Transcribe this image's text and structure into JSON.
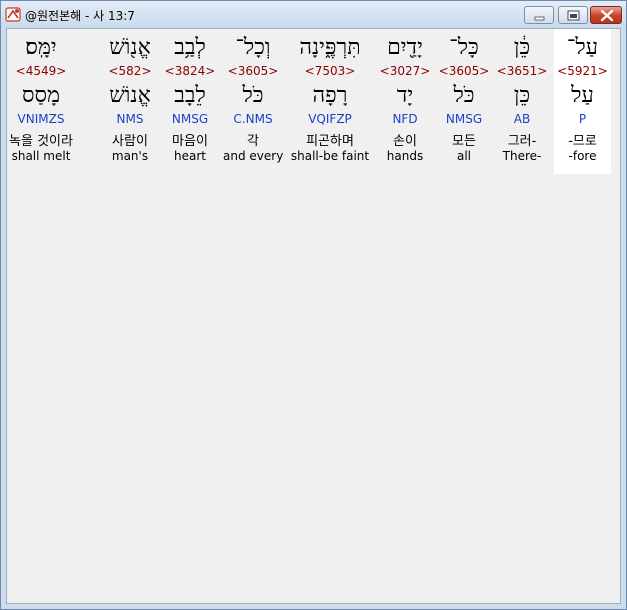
{
  "window": {
    "title": "@원전본해 - 사 13:7"
  },
  "words": [
    {
      "hebrew": "יִמָּֽס׃",
      "strong": "<4549>",
      "lemma": "מָסַס",
      "morph": "VNIMZS",
      "korean": "녹을 것이라",
      "english": "shall melt"
    },
    {
      "hebrew": "אֱנ֖וֹשׁ",
      "strong": "<582>",
      "lemma": "אֱנוֹשׁ",
      "morph": "NMS",
      "korean": "사람이",
      "english": "man's"
    },
    {
      "hebrew": "לְבַ֥ב",
      "strong": "<3824>",
      "lemma": "לֵבָב",
      "morph": "NMSG",
      "korean": "마음이",
      "english": "heart"
    },
    {
      "hebrew": "וְכָל־",
      "strong": "<3605>",
      "lemma": "כֹּל",
      "morph": "C.NMS",
      "korean": "각",
      "english": "and every"
    },
    {
      "hebrew": "תִּרְפֶּ֑ינָה",
      "strong": "<7503>",
      "lemma": "רָפָה",
      "morph": "VQIFZP",
      "korean": "피곤하며",
      "english": "shall-be faint"
    },
    {
      "hebrew": "יָדַ֖יִם",
      "strong": "<3027>",
      "lemma": "יָד",
      "morph": "NFD",
      "korean": "손이",
      "english": "hands"
    },
    {
      "hebrew": "כָּל־",
      "strong": "<3605>",
      "lemma": "כֹּל",
      "morph": "NMSG",
      "korean": "모든",
      "english": "all"
    },
    {
      "hebrew": "כֵּ֔ן",
      "strong": "<3651>",
      "lemma": "כֵּן",
      "morph": "AB",
      "korean": "그러-",
      "english": "There-"
    },
    {
      "hebrew": "עַל־",
      "strong": "<5921>",
      "lemma": "עַל",
      "morph": "P",
      "korean": "-므로",
      "english": "-fore"
    }
  ]
}
